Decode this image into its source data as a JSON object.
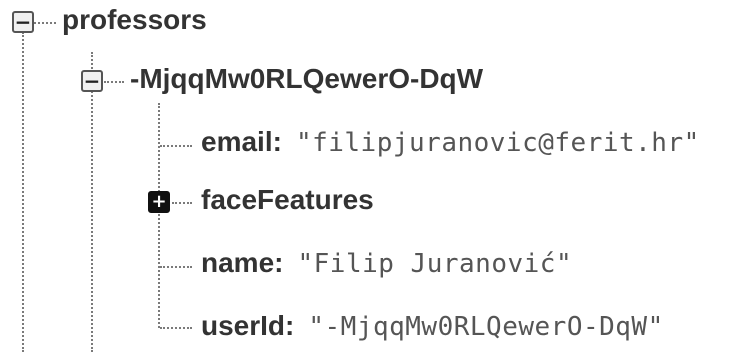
{
  "tree": {
    "root": {
      "key": "professors",
      "toggle": "−",
      "toggle_icon": "collapse-icon",
      "children": [
        {
          "key": "-MjqqMw0RLQewerO-DqW",
          "toggle": "−",
          "toggle_icon": "collapse-icon",
          "children": [
            {
              "key": "email",
              "colon": ":",
              "value": "\"filipjuranovic@ferit.hr\""
            },
            {
              "key": "faceFeatures",
              "toggle": "+",
              "toggle_icon": "expand-icon"
            },
            {
              "key": "name",
              "colon": ":",
              "value": "\"Filip Juranović\""
            },
            {
              "key": "userId",
              "colon": ":",
              "value": "\"-MjqqMw0RLQewerO-DqW\""
            }
          ]
        }
      ]
    }
  }
}
